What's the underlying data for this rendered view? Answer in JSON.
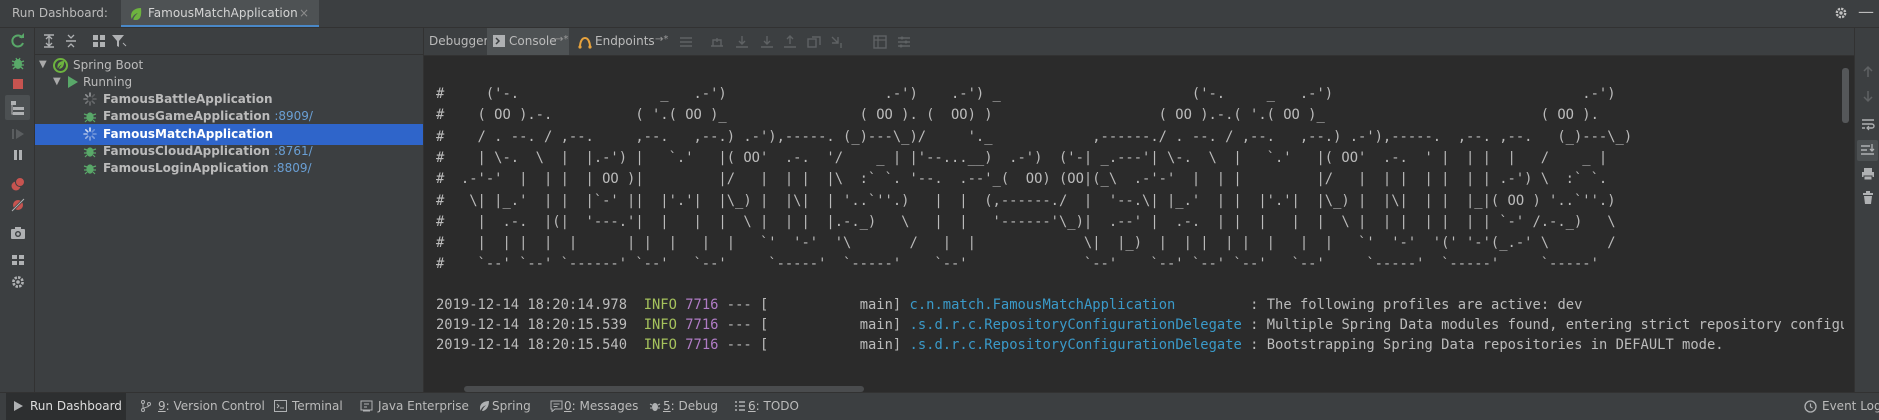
{
  "titlebar": {
    "title": "Run Dashboard:",
    "tab_label": "FamousMatchApplication",
    "close_glyph": "×",
    "minimize_glyph": "—"
  },
  "tree": {
    "root_label": "Spring Boot",
    "group_label": "Running",
    "apps": [
      {
        "name": "FamousBattleApplication",
        "port": "",
        "status": "starting"
      },
      {
        "name": "FamousGameApplication",
        "port": ":8909/",
        "status": "running"
      },
      {
        "name": "FamousMatchApplication",
        "port": "",
        "status": "starting",
        "selected": true
      },
      {
        "name": "FamousCloudApplication",
        "port": ":8761/",
        "status": "running"
      },
      {
        "name": "FamousLoginApplication",
        "port": ":8809/",
        "status": "running"
      }
    ]
  },
  "console_tabs": {
    "debugger": "Debugger",
    "console": "Console",
    "endpoints": "Endpoints",
    "pin_glyph": "→*"
  },
  "banner": [
    "#     ('-.                 _   .-')                   .-')    .-') _                       ('-.     _   .-')                              .-')",
    "#    ( OO ).-.          ( '.( OO )_                ( OO ). (  OO) )                    ( OO ).-.( '.( OO )_                          ( OO ).",
    "#    / . --. / ,--.     ,--.   ,--.) .-'),-----. (_)---\\_)/     '._            ,------./ . --. / ,--.   ,--.) .-'),-----.  ,--. ,--.   (_)---\\_)",
    "#    | \\-.  \\  |  |.-') |   `.'   |( OO'  .-.  '/    _ | |'--...__)  .-')  ('-| _.---'| \\-.  \\  |   `.'   |( OO'  .-.  ' |  | |  |   /    _ |",
    "#  .-'-'  |  | |  | OO )|         |/   |  | |  |\\  :` `. '--.  .--'_(  OO) (OO|(_\\  .-'-'  |  | |         |/   |  | |  | |  | | .-') \\  :` `.",
    "#   \\| |_.'  | |  |`-' ||  |'.'|  |\\_) |  |\\|  | '..`''.)   |  |  (,------./  |  '--.\\| |_.'  | |  |'.'|  |\\_) |  |\\|  | |  |_|( OO ) '..`''.)",
    "#    |  .-.  |(|  '---.'|  |   |  |  \\ |  | |  |.-._)   \\   |  |   '------'\\_)|  .--' |  .-.  | |  |   |  |  \\ |  | |  | |  | | `-' /.-._)   \\",
    "#    |  | |  |  |      | |  |   |  |   `'  '-'  '\\       /   |  |             \\|  |_)  |  | |  | |  |   |  |   `'  '-'  '(' '-'(_.-' \\       /",
    "#    `--' `--' `------' `--'   `--'     `-----'  `-----'    `--'              `--'    `--' `--' `--'   `--'     `-----'  `-----'     `-----'"
  ],
  "log": [
    {
      "timestamp": "2019-12-14 18:20:14.978",
      "level": "INFO",
      "pid": "7716",
      "sep": "---",
      "thread": "[           main]",
      "logger": "c.n.match.FamousMatchApplication        ",
      "message": ": The following profiles are active: dev"
    },
    {
      "timestamp": "2019-12-14 18:20:15.539",
      "level": "INFO",
      "pid": "7716",
      "sep": "---",
      "thread": "[           main]",
      "logger": ".s.d.r.c.RepositoryConfigurationDelegate",
      "message": ": Multiple Spring Data modules found, entering strict repository configuration m"
    },
    {
      "timestamp": "2019-12-14 18:20:15.540",
      "level": "INFO",
      "pid": "7716",
      "sep": "---",
      "thread": "[           main]",
      "logger": ".s.d.r.c.RepositoryConfigurationDelegate",
      "message": ": Bootstrapping Spring Data repositories in DEFAULT mode."
    }
  ],
  "statusbar": {
    "run_dashboard": "Run Dashboard",
    "version_control_num": "9",
    "version_control": ": Version Control",
    "terminal": "Terminal",
    "java_enterprise": "Java Enterprise",
    "spring": "Spring",
    "messages_num": "0",
    "messages": ": Messages",
    "debug_num": "5",
    "debug": ": Debug",
    "todo_num": "6",
    "todo": ": TODO",
    "event_log": "Event Log"
  },
  "colors": {
    "accent": "#4a88c7",
    "selection": "#2f65ca",
    "info": "#a5c25c",
    "pid": "#b07cc5",
    "logger": "#3a9ac9",
    "spring_green": "#6db33f"
  }
}
